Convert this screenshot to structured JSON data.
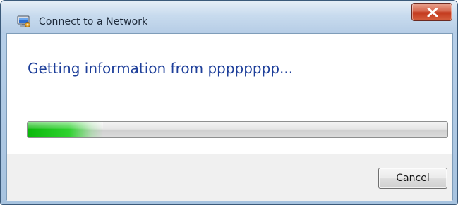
{
  "window": {
    "title": "Connect to a Network",
    "title_icon": "network-icon",
    "close_icon": "close-icon",
    "close_color": "#c3391d"
  },
  "content": {
    "heading": "Getting information from pppppppp...",
    "heading_color": "#1e3f9a",
    "progress": {
      "fraction": 0.18,
      "color": "#0bb80b"
    }
  },
  "buttons": {
    "cancel_label": "Cancel"
  }
}
